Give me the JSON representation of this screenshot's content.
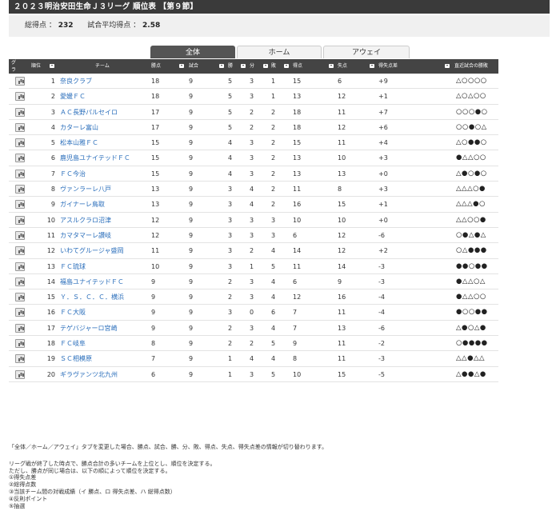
{
  "title": "２０２３明治安田生命Ｊ３リーグ 順位表 【第９節】",
  "summary": {
    "total_label": "総得点 ：",
    "total_value": "232",
    "avg_label": "試合平均得点 ：",
    "avg_value": "2.58"
  },
  "tabs": [
    {
      "label": "全体",
      "active": true
    },
    {
      "label": "ホーム",
      "active": false
    },
    {
      "label": "アウェイ",
      "active": false
    }
  ],
  "headers": {
    "graph": "グラフ",
    "rank": "順位",
    "team": "チーム",
    "pts": "勝点",
    "games": "試合",
    "win": "勝",
    "draw": "分",
    "loss": "敗",
    "gf": "得点",
    "ga": "失点",
    "gd": "得失点差",
    "recent": "直近試合の勝敗"
  },
  "rows": [
    {
      "rank": "1",
      "team": "奈良クラブ",
      "pts": "18",
      "games": "9",
      "win": "5",
      "draw": "3",
      "loss": "1",
      "gf": "15",
      "ga": "6",
      "gd": "+9",
      "recent": "△○○○○"
    },
    {
      "rank": "2",
      "team": "愛媛ＦＣ",
      "pts": "18",
      "games": "9",
      "win": "5",
      "draw": "3",
      "loss": "1",
      "gf": "13",
      "ga": "12",
      "gd": "+1",
      "recent": "△○△○○"
    },
    {
      "rank": "3",
      "team": "ＡＣ長野パルセイロ",
      "pts": "17",
      "games": "9",
      "win": "5",
      "draw": "2",
      "loss": "2",
      "gf": "18",
      "ga": "11",
      "gd": "+7",
      "recent": "○○○●○"
    },
    {
      "rank": "4",
      "team": "カターレ富山",
      "pts": "17",
      "games": "9",
      "win": "5",
      "draw": "2",
      "loss": "2",
      "gf": "18",
      "ga": "12",
      "gd": "+6",
      "recent": "○○●○△"
    },
    {
      "rank": "5",
      "team": "松本山雅ＦＣ",
      "pts": "15",
      "games": "9",
      "win": "4",
      "draw": "3",
      "loss": "2",
      "gf": "15",
      "ga": "11",
      "gd": "+4",
      "recent": "△○●●○"
    },
    {
      "rank": "6",
      "team": "鹿児島ユナイテッドＦＣ",
      "pts": "15",
      "games": "9",
      "win": "4",
      "draw": "3",
      "loss": "2",
      "gf": "13",
      "ga": "10",
      "gd": "+3",
      "recent": "●△△○○"
    },
    {
      "rank": "7",
      "team": "ＦＣ今治",
      "pts": "15",
      "games": "9",
      "win": "4",
      "draw": "3",
      "loss": "2",
      "gf": "13",
      "ga": "13",
      "gd": "+0",
      "recent": "△●○●○"
    },
    {
      "rank": "8",
      "team": "ヴァンラーレ八戸",
      "pts": "13",
      "games": "9",
      "win": "3",
      "draw": "4",
      "loss": "2",
      "gf": "11",
      "ga": "8",
      "gd": "+3",
      "recent": "△△△○●"
    },
    {
      "rank": "9",
      "team": "ガイナーレ鳥取",
      "pts": "13",
      "games": "9",
      "win": "3",
      "draw": "4",
      "loss": "2",
      "gf": "16",
      "ga": "15",
      "gd": "+1",
      "recent": "△△△●○"
    },
    {
      "rank": "10",
      "team": "アスルクラロ沼津",
      "pts": "12",
      "games": "9",
      "win": "3",
      "draw": "3",
      "loss": "3",
      "gf": "10",
      "ga": "10",
      "gd": "+0",
      "recent": "△△○○●"
    },
    {
      "rank": "11",
      "team": "カマタマーレ讃岐",
      "pts": "12",
      "games": "9",
      "win": "3",
      "draw": "3",
      "loss": "3",
      "gf": "6",
      "ga": "12",
      "gd": "-6",
      "recent": "○●△●△"
    },
    {
      "rank": "12",
      "team": "いわてグルージャ盛岡",
      "pts": "11",
      "games": "9",
      "win": "3",
      "draw": "2",
      "loss": "4",
      "gf": "14",
      "ga": "12",
      "gd": "+2",
      "recent": "○△●●●"
    },
    {
      "rank": "13",
      "team": "ＦＣ琉球",
      "pts": "10",
      "games": "9",
      "win": "3",
      "draw": "1",
      "loss": "5",
      "gf": "11",
      "ga": "14",
      "gd": "-3",
      "recent": "●●○●●"
    },
    {
      "rank": "14",
      "team": "福島ユナイテッドＦＣ",
      "pts": "9",
      "games": "9",
      "win": "2",
      "draw": "3",
      "loss": "4",
      "gf": "6",
      "ga": "9",
      "gd": "-3",
      "recent": "●△△○△"
    },
    {
      "rank": "15",
      "team": "Ｙ．Ｓ．Ｃ．Ｃ．横浜",
      "pts": "9",
      "games": "9",
      "win": "2",
      "draw": "3",
      "loss": "4",
      "gf": "12",
      "ga": "16",
      "gd": "-4",
      "recent": "●△△○○"
    },
    {
      "rank": "16",
      "team": "ＦＣ大阪",
      "pts": "9",
      "games": "9",
      "win": "3",
      "draw": "0",
      "loss": "6",
      "gf": "7",
      "ga": "11",
      "gd": "-4",
      "recent": "●○○●●"
    },
    {
      "rank": "17",
      "team": "テゲバジャーロ宮崎",
      "pts": "9",
      "games": "9",
      "win": "2",
      "draw": "3",
      "loss": "4",
      "gf": "7",
      "ga": "13",
      "gd": "-6",
      "recent": "△●○△●"
    },
    {
      "rank": "18",
      "team": "ＦＣ岐阜",
      "pts": "8",
      "games": "9",
      "win": "2",
      "draw": "2",
      "loss": "5",
      "gf": "9",
      "ga": "11",
      "gd": "-2",
      "recent": "○●●●●"
    },
    {
      "rank": "19",
      "team": "ＳＣ相模原",
      "pts": "7",
      "games": "9",
      "win": "1",
      "draw": "4",
      "loss": "4",
      "gf": "8",
      "ga": "11",
      "gd": "-3",
      "recent": "△△●△△"
    },
    {
      "rank": "20",
      "team": "ギラヴァンツ北九州",
      "pts": "6",
      "games": "9",
      "win": "1",
      "draw": "3",
      "loss": "5",
      "gf": "10",
      "ga": "15",
      "gd": "-5",
      "recent": "△●●△●"
    }
  ],
  "notes": {
    "tab_note": "「全体／ホーム／アウェイ」タブを変更した場合、勝点、試合、勝、分、敗、得点、失点、得失点差の情報が切り替わります。",
    "rules": [
      "リーグ戦が終了した時点で、勝点合計の多いチームを上位とし、順位を決定する。",
      "ただし、勝点が同じ場合は、以下の順によって順位を決定する。",
      "①得失点差",
      "②総得点数",
      "③当該チーム間の対戦成績（イ 勝点、ロ 得失点差、ハ 総得点数）",
      "④反則ポイント",
      "⑤抽選"
    ]
  }
}
